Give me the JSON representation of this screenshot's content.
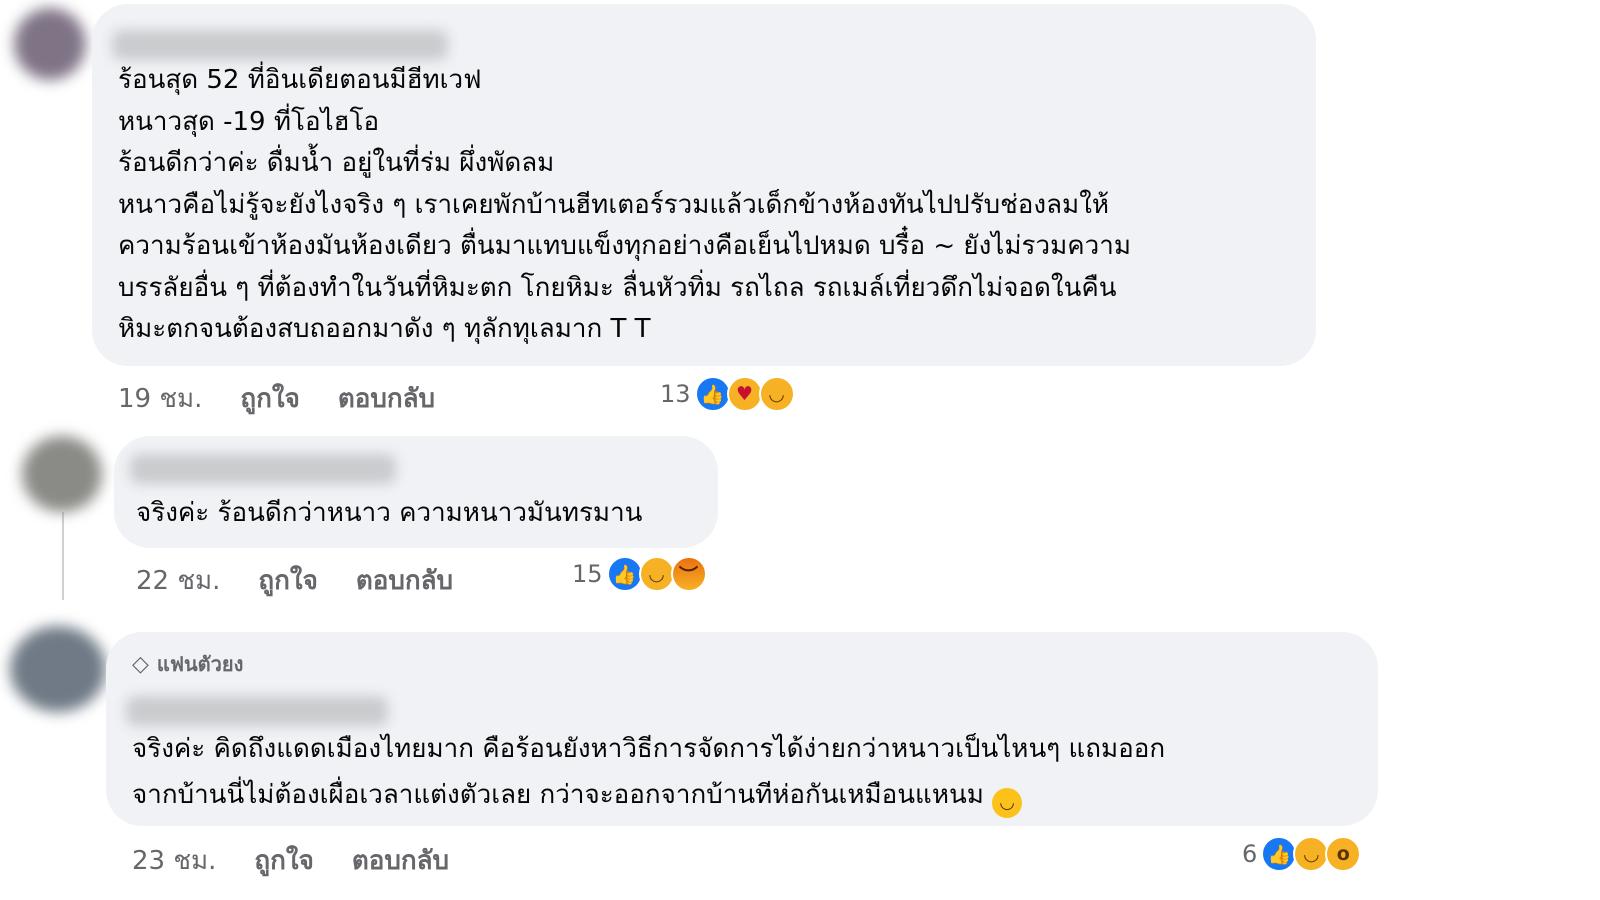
{
  "comments": [
    {
      "lines": [
        "ร้อนสุด 52 ที่อินเดียตอนมีฮีทเวฟ",
        "หนาวสุด -19 ที่โอไฮโอ",
        "ร้อนดีกว่าค่ะ ดื่มน้ำ อยู่ในที่ร่ม ผึ่งพัดลม",
        "หนาวคือไม่รู้จะยังไงจริง ๆ เราเคยพักบ้านฮีทเตอร์รวมแล้วเด็กข้างห้องทันไปปรับช่องลมให้",
        "ความร้อนเข้าห้องมันห้องเดียว ตื่นมาแทบแข็งทุกอย่างคือเย็นไปหมด บรื๋อ ~ ยังไม่รวมความ",
        "บรรลัยอื่น ๆ ที่ต้องทำในวันที่หิมะตก โกยหิมะ ลื่นหัวทิ่ม รถไถล รถเมล์เที่ยวดึกไม่จอดในคืน",
        "หิมะตกจนต้องสบถออกมาดัง ๆ ทุลักทุเลมาก T T"
      ],
      "time": "19 ชม.",
      "like_label": "ถูกใจ",
      "reply_label": "ตอบกลับ",
      "reaction_count": "13",
      "reactions": [
        "like-icon",
        "care-icon",
        "laugh-icon"
      ]
    },
    {
      "lines": [
        "จริงค่ะ ร้อนดีกว่าหนาว ความหนาวมันทรมาน"
      ],
      "time": "22 ชม.",
      "like_label": "ถูกใจ",
      "reply_label": "ตอบกลับ",
      "reaction_count": "15",
      "reactions": [
        "like-icon",
        "laugh-icon",
        "angry-icon"
      ]
    },
    {
      "badge": "แฟนตัวยง",
      "lines": [
        "จริงค่ะ คิดถึงแดดเมืองไทยมาก คือร้อนยังหาวิธีการจัดการได้ง่ายกว่าหนาวเป็นไหนๆ แถมออก",
        "จากบ้านนี่ไม่ต้องเผื่อเวลาแต่งตัวเลย กว่าจะออกจากบ้านทีห่อกันเหมือนแหนม"
      ],
      "time": "23 ชม.",
      "like_label": "ถูกใจ",
      "reply_label": "ตอบกลับ",
      "reaction_count": "6",
      "reactions": [
        "like-icon",
        "laugh-icon",
        "wow-icon"
      ]
    }
  ],
  "colors": {
    "bubble": "#f0f2f5",
    "meta_text": "#65676b",
    "like_blue": "#1877f2",
    "emoji_yellow": "#f7b125"
  }
}
